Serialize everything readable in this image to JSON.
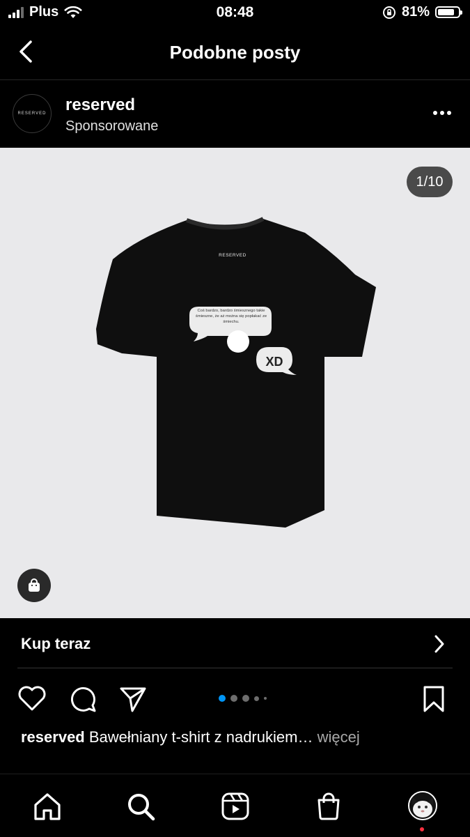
{
  "status_bar": {
    "carrier": "Plus",
    "time": "08:48",
    "battery": "81%",
    "battery_level": 0.81
  },
  "header": {
    "title": "Podobne posty"
  },
  "post": {
    "username": "reserved",
    "sponsored": "Sponsorowane",
    "image_counter": "1/10",
    "shirt": {
      "label": "RESERVED",
      "bubble_text": "Coś bardzo, bardzo śmiesznego takie śmieszne, że aż można się popłakać ze śmiechu.",
      "reply_text": "XD"
    },
    "buy_now": "Kup teraz",
    "carousel_dots": 5,
    "carousel_active": 0,
    "caption_user": "reserved",
    "caption_text": "Bawełniany t-shirt z nadrukiem…",
    "caption_more": "więcej"
  },
  "icons": [
    "back-arrow-icon",
    "more-options-icon",
    "shopping-bag-icon",
    "chevron-right-icon",
    "heart-icon",
    "comment-icon",
    "share-icon",
    "bookmark-icon",
    "home-icon",
    "search-icon",
    "reels-icon",
    "shop-icon"
  ],
  "colors": {
    "accent_blue": "#0095f6",
    "notification_red": "#ff3040",
    "image_bg": "#e9e9eb"
  }
}
